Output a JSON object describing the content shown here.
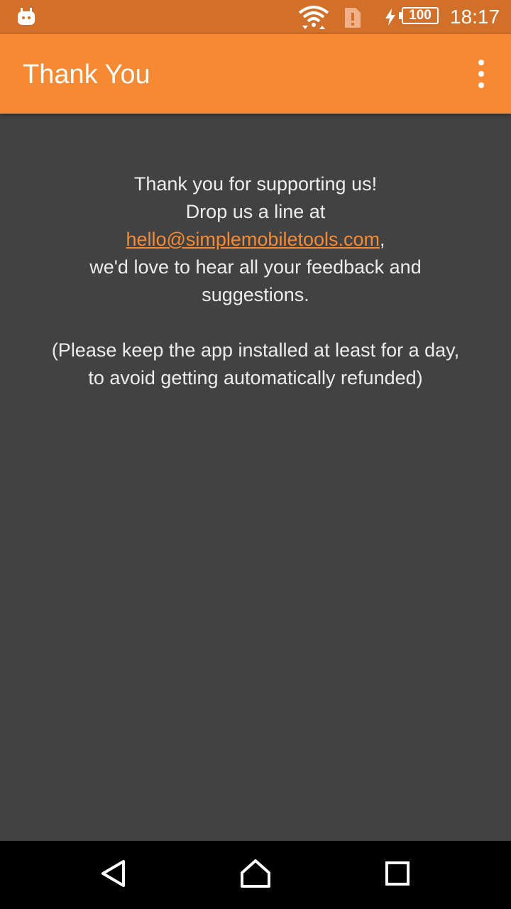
{
  "status_bar": {
    "battery_level": "100",
    "time": "18:17"
  },
  "app_bar": {
    "title": "Thank You"
  },
  "message": {
    "line1": "Thank you for supporting us!",
    "line2": "Drop us a line at",
    "email": "hello@simplemobiletools.com",
    "email_suffix": ",",
    "line3": "we'd love to hear all your feedback and suggestions.",
    "note": "(Please keep the app installed at least for a day, to avoid getting automatically refunded)"
  },
  "colors": {
    "accent": "#f68a33",
    "status_bar": "#d2702a",
    "background": "#424242",
    "text": "#ececec"
  },
  "icons": {
    "status_left": "android-notification-icon",
    "wifi": "wifi-icon",
    "sim": "sim-alert-icon",
    "charging": "charging-icon",
    "overflow": "more-vert-icon",
    "back": "back-icon",
    "home": "home-icon",
    "recents": "recents-icon"
  }
}
